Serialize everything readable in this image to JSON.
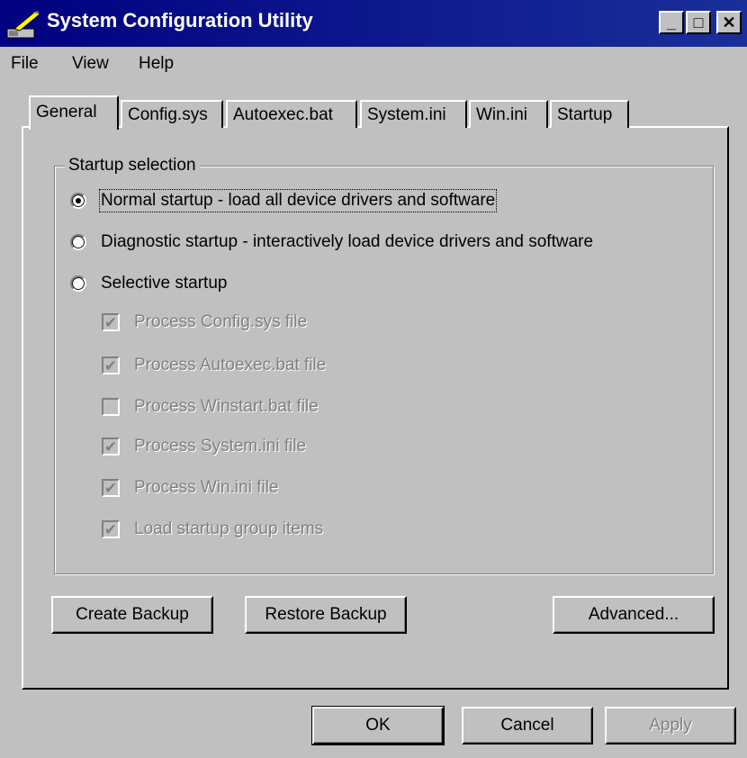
{
  "window": {
    "title": "System Configuration Utility",
    "min_glyph": "_",
    "max_glyph": "□",
    "close_glyph": "✕"
  },
  "menu": [
    {
      "label": "File"
    },
    {
      "label": "View"
    },
    {
      "label": "Help"
    }
  ],
  "tabs": [
    {
      "label": "General",
      "active": true
    },
    {
      "label": "Config.sys"
    },
    {
      "label": "Autoexec.bat"
    },
    {
      "label": "System.ini"
    },
    {
      "label": "Win.ini"
    },
    {
      "label": "Startup"
    }
  ],
  "startup_selection": {
    "title": "Startup selection",
    "radios": [
      {
        "label": "Normal startup - load all device drivers and software",
        "selected": true
      },
      {
        "label": "Diagnostic startup - interactively load device drivers and software",
        "selected": false
      },
      {
        "label": "Selective startup",
        "selected": false
      }
    ],
    "checkboxes": [
      {
        "label": "Process Config.sys file",
        "checked": true
      },
      {
        "label": "Process Autoexec.bat file",
        "checked": true
      },
      {
        "label": "Process Winstart.bat file",
        "checked": false
      },
      {
        "label": "Process System.ini file",
        "checked": true
      },
      {
        "label": "Process Win.ini file",
        "checked": true
      },
      {
        "label": "Load startup group items",
        "checked": true
      }
    ]
  },
  "buttons": {
    "create_backup": "Create Backup",
    "restore_backup": "Restore Backup",
    "advanced": "Advanced...",
    "ok": "OK",
    "cancel": "Cancel",
    "apply": "Apply"
  },
  "colors": {
    "titlebar": "#000080",
    "face": "#c0c0c0",
    "disabled_text": "#808080"
  }
}
